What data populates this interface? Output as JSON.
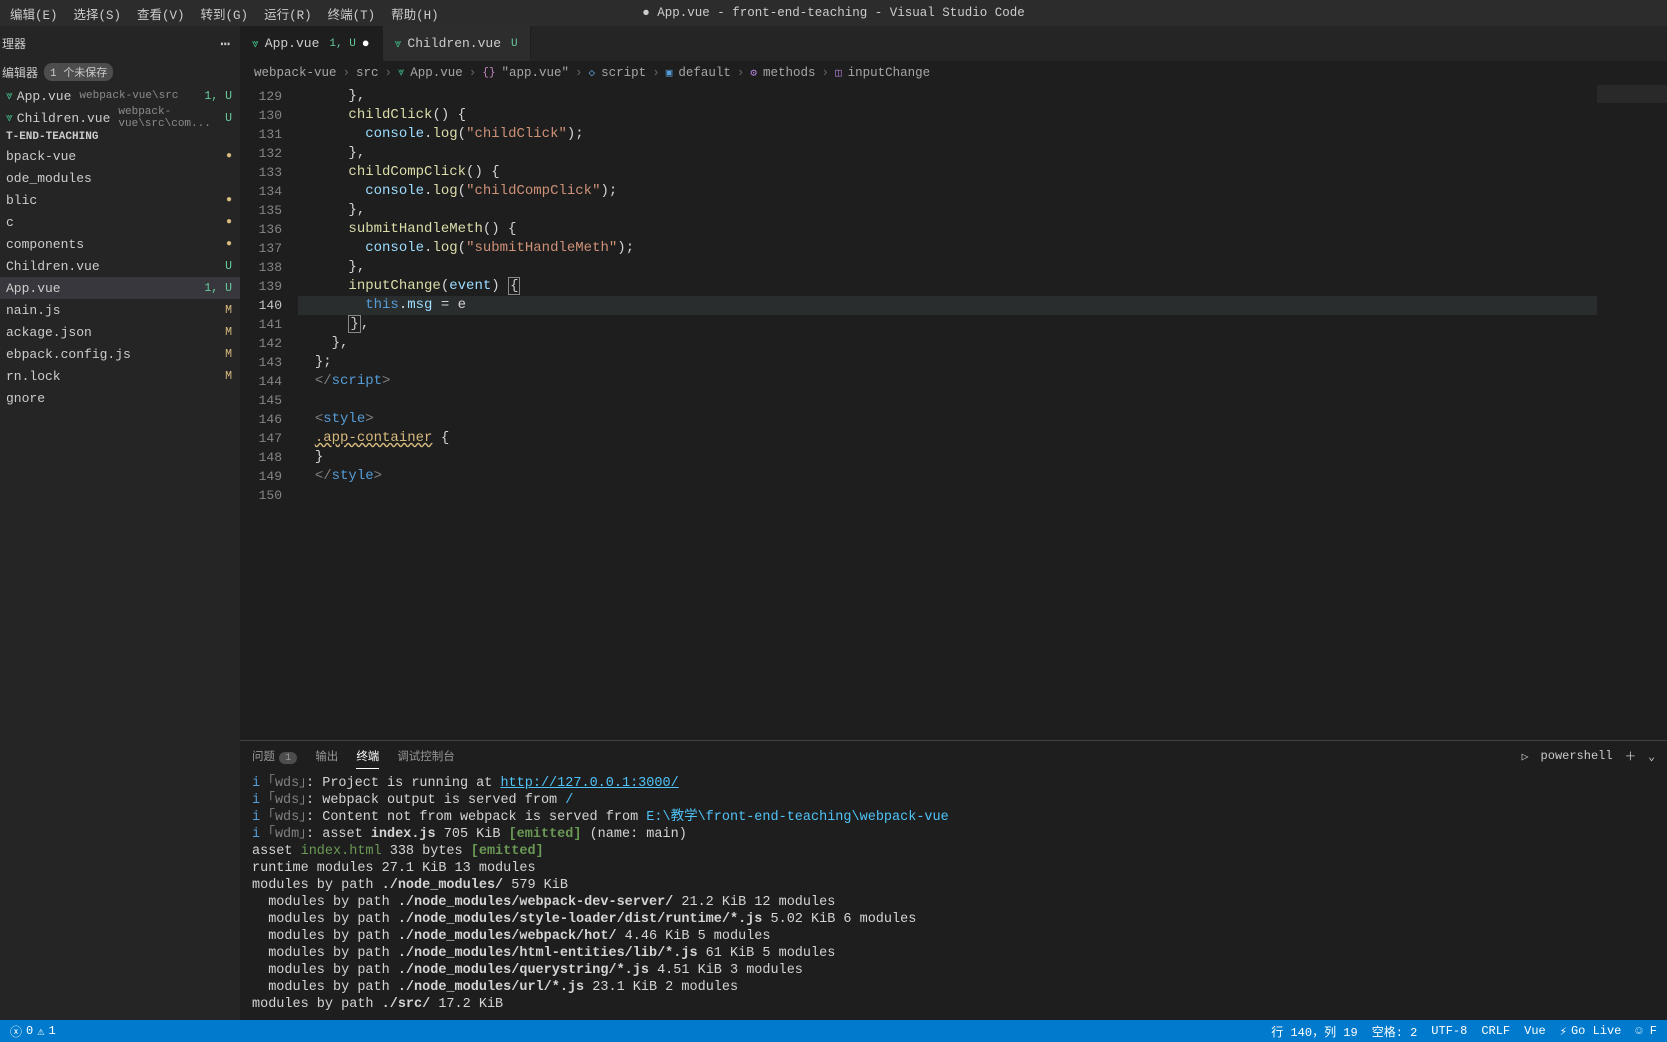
{
  "window": {
    "title": "● App.vue - front-end-teaching - Visual Studio Code"
  },
  "menu": [
    "编辑(E)",
    "选择(S)",
    "查看(V)",
    "转到(G)",
    "运行(R)",
    "终端(T)",
    "帮助(H)"
  ],
  "sidebar": {
    "header": "理器",
    "openEditorsLabel": "编辑器",
    "unsavedBadge": "1 个未保存",
    "openEditors": [
      {
        "name": "App.vue",
        "path": "webpack-vue\\src",
        "status": "1, U"
      },
      {
        "name": "Children.vue",
        "path": "webpack-vue\\src\\com...",
        "status": "U"
      }
    ],
    "projectName": "T-END-TEACHING",
    "files": [
      {
        "name": "bpack-vue",
        "status": "●",
        "statusClass": "dot-mod"
      },
      {
        "name": "ode_modules",
        "status": ""
      },
      {
        "name": "blic",
        "status": "●",
        "statusClass": "dot-mod"
      },
      {
        "name": "c",
        "status": "●",
        "statusClass": "dot-mod"
      },
      {
        "name": "components",
        "status": "●",
        "statusClass": "dot-mod"
      },
      {
        "name": "Children.vue",
        "status": "U",
        "statusClass": "status-u"
      },
      {
        "name": "App.vue",
        "status": "1, U",
        "statusClass": "status-u",
        "active": true
      },
      {
        "name": "nain.js",
        "status": "M",
        "statusClass": "status-m"
      },
      {
        "name": "ackage.json",
        "status": "M",
        "statusClass": "status-m"
      },
      {
        "name": "ebpack.config.js",
        "status": "M",
        "statusClass": "status-m"
      },
      {
        "name": "rn.lock",
        "status": "M",
        "statusClass": "status-m"
      },
      {
        "name": "gnore",
        "status": ""
      }
    ]
  },
  "tabs": [
    {
      "name": "App.vue",
      "status": "1, U",
      "active": true,
      "modified": true
    },
    {
      "name": "Children.vue",
      "status": "U"
    }
  ],
  "breadcrumb": [
    "webpack-vue",
    "src",
    "App.vue",
    "\"app.vue\"",
    "script",
    "default",
    "methods",
    "inputChange"
  ],
  "editor": {
    "startLine": 129,
    "activeLine": 140
  },
  "panel": {
    "tabs": {
      "problems": "问题",
      "problemsCount": "1",
      "output": "输出",
      "terminal": "终端",
      "debug": "调试控制台"
    },
    "shell": "powershell"
  },
  "terminal": {
    "l1_a": "i ",
    "l1_b": "｢wds｣",
    "l1_c": ": Project is running at ",
    "l1_d": "http://127.0.0.1:3000/",
    "l2_a": "i ",
    "l2_b": "｢wds｣",
    "l2_c": ": webpack output is served from ",
    "l2_d": "/",
    "l3_a": "i ",
    "l3_b": "｢wds｣",
    "l3_c": ": Content not from webpack is served from ",
    "l3_d": "E:\\教学\\front-end-teaching\\webpack-vue",
    "l4_a": "i ",
    "l4_b": "｢wdm｣",
    "l4_c": ": asset ",
    "l4_d": "index.js",
    "l4_e": " 705 KiB ",
    "l4_f": "[emitted]",
    "l4_g": " (name: main)",
    "l5_a": "asset ",
    "l5_b": "index.html",
    "l5_c": " 338 bytes ",
    "l5_d": "[emitted]",
    "l6": "runtime modules 27.1 KiB 13 modules",
    "l7_a": "modules by path ",
    "l7_b": "./node_modules/",
    "l7_c": " 579 KiB",
    "l8_a": "  modules by path ",
    "l8_b": "./node_modules/webpack-dev-server/",
    "l8_c": " 21.2 KiB 12 modules",
    "l9_a": "  modules by path ",
    "l9_b": "./node_modules/style-loader/dist/runtime/*.js",
    "l9_c": " 5.02 KiB 6 modules",
    "l10_a": "  modules by path ",
    "l10_b": "./node_modules/webpack/hot/",
    "l10_c": " 4.46 KiB 5 modules",
    "l11_a": "  modules by path ",
    "l11_b": "./node_modules/html-entities/lib/*.js",
    "l11_c": " 61 KiB 5 modules",
    "l12_a": "  modules by path ",
    "l12_b": "./node_modules/querystring/*.js",
    "l12_c": " 4.51 KiB 3 modules",
    "l13_a": "  modules by path ",
    "l13_b": "./node_modules/url/*.js",
    "l13_c": " 23.1 KiB 2 modules",
    "l14_a": "modules by path ",
    "l14_b": "./src/",
    "l14_c": " 17.2 KiB"
  },
  "statusbar": {
    "errors": "0",
    "warnings": "1",
    "pos": "行 140，列 19",
    "spaces": "空格: 2",
    "encoding": "UTF-8",
    "eol": "CRLF",
    "lang": "Vue",
    "live": "Go Live"
  }
}
